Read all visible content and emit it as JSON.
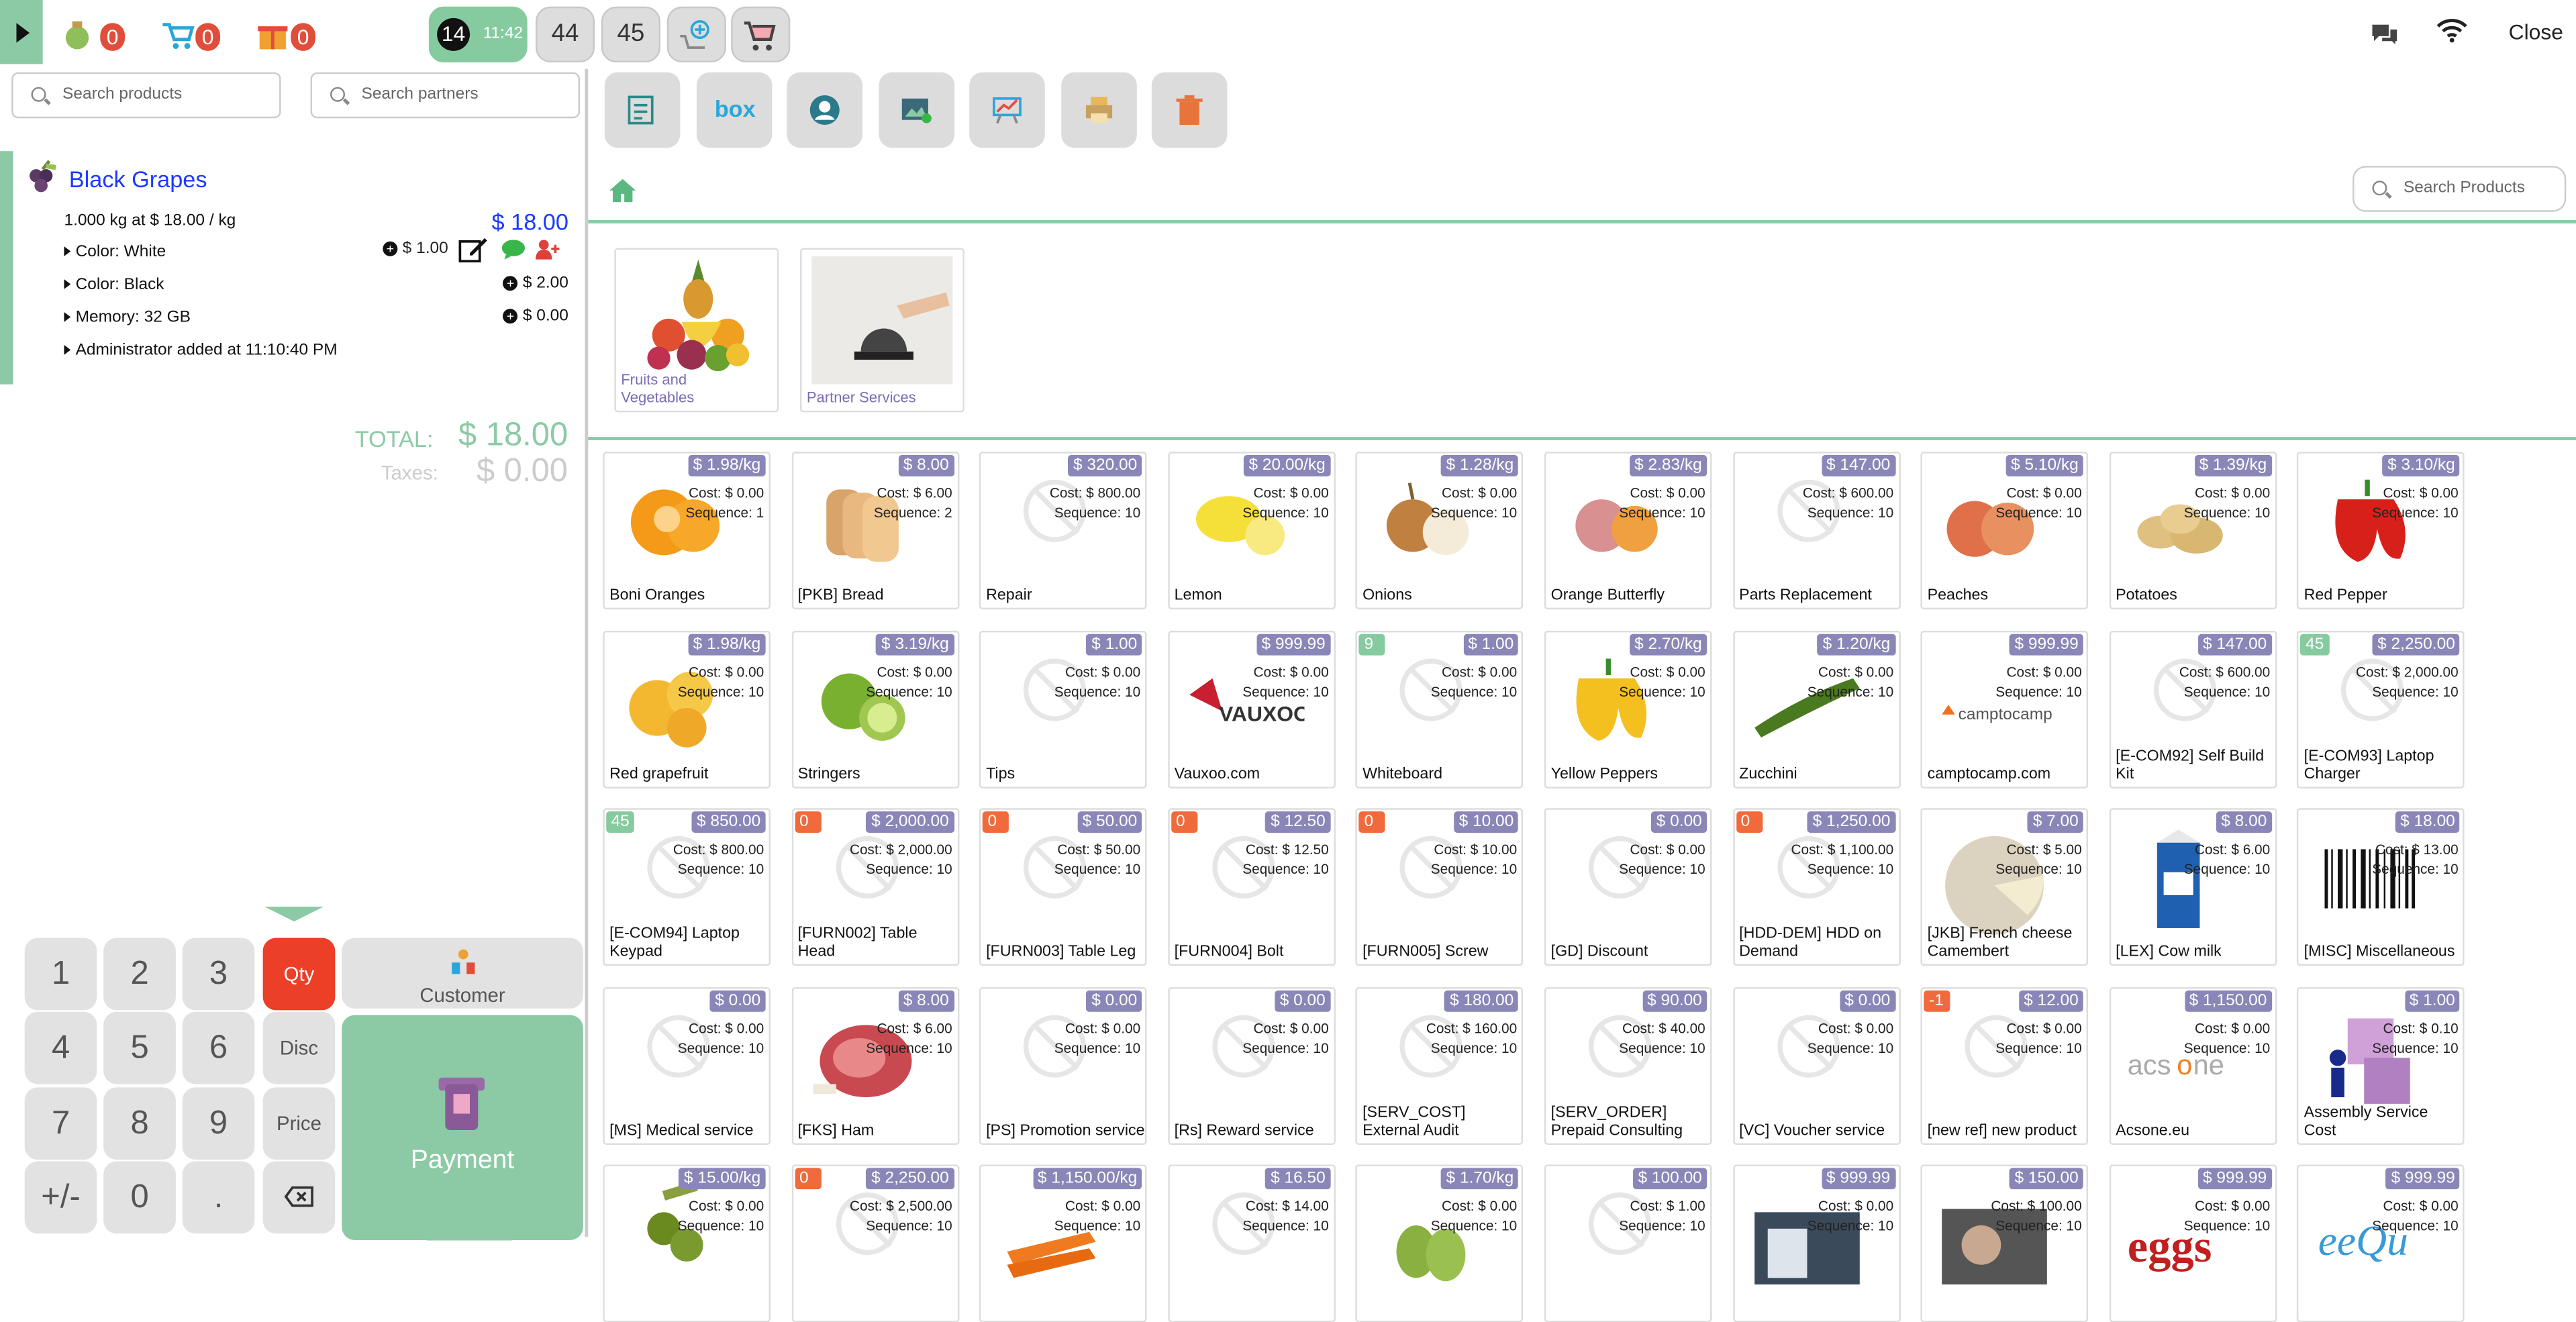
{
  "topbar": {
    "counters": [
      {
        "name": "orders-counter",
        "value": "0"
      },
      {
        "name": "cart-counter",
        "value": "0"
      },
      {
        "name": "gift-counter",
        "value": "0"
      }
    ],
    "orders": [
      {
        "num": "14",
        "time": "11:42",
        "active": true
      },
      {
        "label": "44"
      },
      {
        "label": "45"
      }
    ],
    "close_label": "Close"
  },
  "left": {
    "search_products": "Search products",
    "search_partners": "Search partners",
    "line": {
      "product": "Black Grapes",
      "detail": "1.000 kg at $ 18.00 / kg",
      "price": "$ 18.00",
      "attributes": [
        {
          "label": "Color: White",
          "price": "$ 1.00"
        },
        {
          "label": "Color: Black",
          "price": "$ 2.00"
        },
        {
          "label": "Memory: 32 GB",
          "price": "$ 0.00"
        },
        {
          "label": "Administrator added at 11:10:40 PM",
          "price": ""
        }
      ]
    },
    "total_label": "TOTAL:",
    "total_value": "$ 18.00",
    "taxes_label": "Taxes:",
    "taxes_value": "$ 0.00",
    "numpad": {
      "keys": [
        "1",
        "2",
        "3",
        "4",
        "5",
        "6",
        "7",
        "8",
        "9",
        "+/-",
        "0",
        "."
      ],
      "qty": "Qty",
      "disc": "Disc",
      "price": "Price",
      "customer": "Customer",
      "payment": "Payment"
    }
  },
  "right": {
    "search_products": "Search Products",
    "categories": [
      {
        "label": "Fruits and Vegetables"
      },
      {
        "label": "Partner Services"
      }
    ],
    "products": [
      {
        "name": "Boni Oranges",
        "price": "$ 1.98/kg",
        "cost": "Cost: $ 0.00",
        "seq": "Sequence: 1",
        "img": "orange"
      },
      {
        "name": "[PKB] Bread",
        "price": "$ 8.00",
        "cost": "Cost: $ 6.00",
        "seq": "Sequence: 2",
        "img": "bread"
      },
      {
        "name": "Repair",
        "price": "$ 320.00",
        "cost": "Cost: $ 800.00",
        "seq": "Sequence: 10",
        "img": "none"
      },
      {
        "name": "Lemon",
        "price": "$ 20.00/kg",
        "cost": "Cost: $ 0.00",
        "seq": "Sequence: 10",
        "img": "lemon"
      },
      {
        "name": "Onions",
        "price": "$ 1.28/kg",
        "cost": "Cost: $ 0.00",
        "seq": "Sequence: 10",
        "img": "onion"
      },
      {
        "name": "Orange Butterfly",
        "price": "$ 2.83/kg",
        "cost": "Cost: $ 0.00",
        "seq": "Sequence: 10",
        "img": "butterfly"
      },
      {
        "name": "Parts Replacement",
        "price": "$ 147.00",
        "cost": "Cost: $ 600.00",
        "seq": "Sequence: 10",
        "img": "none"
      },
      {
        "name": "Peaches",
        "price": "$ 5.10/kg",
        "cost": "Cost: $ 0.00",
        "seq": "Sequence: 10",
        "img": "peach"
      },
      {
        "name": "Potatoes",
        "price": "$ 1.39/kg",
        "cost": "Cost: $ 0.00",
        "seq": "Sequence: 10",
        "img": "potato"
      },
      {
        "name": "Red Pepper",
        "price": "$ 3.10/kg",
        "cost": "Cost: $ 0.00",
        "seq": "Sequence: 10",
        "img": "redpepper"
      },
      {
        "name": "Red grapefruit",
        "price": "$ 1.98/kg",
        "cost": "Cost: $ 0.00",
        "seq": "Sequence: 10",
        "img": "grapefruit"
      },
      {
        "name": "Stringers",
        "price": "$ 3.19/kg",
        "cost": "Cost: $ 0.00",
        "seq": "Sequence: 10",
        "img": "lime"
      },
      {
        "name": "Tips",
        "price": "$ 1.00",
        "cost": "Cost: $ 0.00",
        "seq": "Sequence: 10",
        "img": "none"
      },
      {
        "name": "Vauxoo.com",
        "price": "$ 999.99",
        "cost": "Cost: $ 0.00",
        "seq": "Sequence: 10",
        "img": "vauxoo"
      },
      {
        "name": "Whiteboard",
        "price": "$ 1.00",
        "cost": "Cost: $ 0.00",
        "seq": "Sequence: 10",
        "img": "none",
        "qty": "9",
        "qtycolor": "green"
      },
      {
        "name": "Yellow Peppers",
        "price": "$ 2.70/kg",
        "cost": "Cost: $ 0.00",
        "seq": "Sequence: 10",
        "img": "yellowpepper"
      },
      {
        "name": "Zucchini",
        "price": "$ 1.20/kg",
        "cost": "Cost: $ 0.00",
        "seq": "Sequence: 10",
        "img": "zucchini"
      },
      {
        "name": "camptocamp.com",
        "price": "$ 999.99",
        "cost": "Cost: $ 0.00",
        "seq": "Sequence: 10",
        "img": "camptocamp"
      },
      {
        "name": "[E-COM92] Self Build Kit",
        "price": "$ 147.00",
        "cost": "Cost: $ 600.00",
        "seq": "Sequence: 10",
        "img": "none"
      },
      {
        "name": "[E-COM93] Laptop Charger",
        "price": "$ 2,250.00",
        "cost": "Cost: $ 2,000.00",
        "seq": "Sequence: 10",
        "img": "none",
        "qty": "45",
        "qtycolor": "green"
      },
      {
        "name": "[E-COM94] Laptop Keypad",
        "price": "$ 850.00",
        "cost": "Cost: $ 800.00",
        "seq": "Sequence: 10",
        "img": "none",
        "qty": "45",
        "qtycolor": "green"
      },
      {
        "name": "[FURN002] Table Head",
        "price": "$ 2,000.00",
        "cost": "Cost: $ 2,000.00",
        "seq": "Sequence: 10",
        "img": "none",
        "qty": "0",
        "qtycolor": "orange"
      },
      {
        "name": "[FURN003] Table Leg",
        "price": "$ 50.00",
        "cost": "Cost: $ 50.00",
        "seq": "Sequence: 10",
        "img": "none",
        "qty": "0",
        "qtycolor": "orange"
      },
      {
        "name": "[FURN004] Bolt",
        "price": "$ 12.50",
        "cost": "Cost: $ 12.50",
        "seq": "Sequence: 10",
        "img": "none",
        "qty": "0",
        "qtycolor": "orange"
      },
      {
        "name": "[FURN005] Screw",
        "price": "$ 10.00",
        "cost": "Cost: $ 10.00",
        "seq": "Sequence: 10",
        "img": "none",
        "qty": "0",
        "qtycolor": "orange"
      },
      {
        "name": "[GD] Discount",
        "price": "$ 0.00",
        "cost": "Cost: $ 0.00",
        "seq": "Sequence: 10",
        "img": "none"
      },
      {
        "name": "[HDD-DEM] HDD on Demand",
        "price": "$ 1,250.00",
        "cost": "Cost: $ 1,100.00",
        "seq": "Sequence: 10",
        "img": "none",
        "qty": "0",
        "qtycolor": "orange"
      },
      {
        "name": "[JKB] French cheese Camembert",
        "price": "$ 7.00",
        "cost": "Cost: $ 5.00",
        "seq": "Sequence: 10",
        "img": "cheese"
      },
      {
        "name": "[LEX] Cow milk",
        "price": "$ 8.00",
        "cost": "Cost: $ 6.00",
        "seq": "Sequence: 10",
        "img": "milk"
      },
      {
        "name": "[MISC] Miscellaneous",
        "price": "$ 18.00",
        "cost": "Cost: $ 13.00",
        "seq": "Sequence: 10",
        "img": "barcode"
      },
      {
        "name": "[MS] Medical service",
        "price": "$ 0.00",
        "cost": "Cost: $ 0.00",
        "seq": "Sequence: 10",
        "img": "none"
      },
      {
        "name": "[FKS] Ham",
        "price": "$ 8.00",
        "cost": "Cost: $ 6.00",
        "seq": "Sequence: 10",
        "img": "ham"
      },
      {
        "name": "[PS] Promotion service",
        "price": "$ 0.00",
        "cost": "Cost: $ 0.00",
        "seq": "Sequence: 10",
        "img": "none"
      },
      {
        "name": "[Rs] Reward service",
        "price": "$ 0.00",
        "cost": "Cost: $ 0.00",
        "seq": "Sequence: 10",
        "img": "none"
      },
      {
        "name": "[SERV_COST] External Audit",
        "price": "$ 180.00",
        "cost": "Cost: $ 160.00",
        "seq": "Sequence: 10",
        "img": "none"
      },
      {
        "name": "[SERV_ORDER] Prepaid Consulting",
        "price": "$ 90.00",
        "cost": "Cost: $ 40.00",
        "seq": "Sequence: 10",
        "img": "none"
      },
      {
        "name": "[VC] Voucher service",
        "price": "$ 0.00",
        "cost": "Cost: $ 0.00",
        "seq": "Sequence: 10",
        "img": "none"
      },
      {
        "name": "[new ref] new product",
        "price": "$ 12.00",
        "cost": "Cost: $ 0.00",
        "seq": "Sequence: 10",
        "img": "none",
        "qty": "-1",
        "qtycolor": "orange"
      },
      {
        "name": "Acsone.eu",
        "price": "$ 1,150.00",
        "cost": "Cost: $ 0.00",
        "seq": "Sequence: 10",
        "img": "acsone"
      },
      {
        "name": "Assembly Service Cost",
        "price": "$ 1.00",
        "cost": "Cost: $ 0.10",
        "seq": "Sequence: 10",
        "img": "assembly"
      },
      {
        "name": "",
        "price": "$ 15.00/kg",
        "cost": "Cost: $ 0.00",
        "seq": "Sequence: 10",
        "img": "grapes"
      },
      {
        "name": "",
        "price": "$ 2,250.00",
        "cost": "Cost: $ 2,500.00",
        "seq": "Sequence: 10",
        "img": "none",
        "qty": "0",
        "qtycolor": "orange"
      },
      {
        "name": "",
        "price": "$ 1,150.00/kg",
        "cost": "Cost: $ 0.00",
        "seq": "Sequence: 10",
        "img": "carrot"
      },
      {
        "name": "",
        "price": "$ 16.50",
        "cost": "Cost: $ 14.00",
        "seq": "Sequence: 10",
        "img": "none"
      },
      {
        "name": "",
        "price": "$ 1.70/kg",
        "cost": "Cost: $ 0.00",
        "seq": "Sequence: 10",
        "img": "pear"
      },
      {
        "name": "",
        "price": "$ 100.00",
        "cost": "Cost: $ 1.00",
        "seq": "Sequence: 10",
        "img": "none"
      },
      {
        "name": "",
        "price": "$ 999.99",
        "cost": "Cost: $ 0.00",
        "seq": "Sequence: 10",
        "img": "photo1"
      },
      {
        "name": "",
        "price": "$ 150.00",
        "cost": "Cost: $ 100.00",
        "seq": "Sequence: 10",
        "img": "photo2"
      },
      {
        "name": "",
        "price": "$ 999.99",
        "cost": "Cost: $ 0.00",
        "seq": "Sequence: 10",
        "img": "eggs"
      },
      {
        "name": "",
        "price": "$ 999.99",
        "cost": "Cost: $ 0.00",
        "seq": "Sequence: 10",
        "img": "script"
      }
    ]
  }
}
